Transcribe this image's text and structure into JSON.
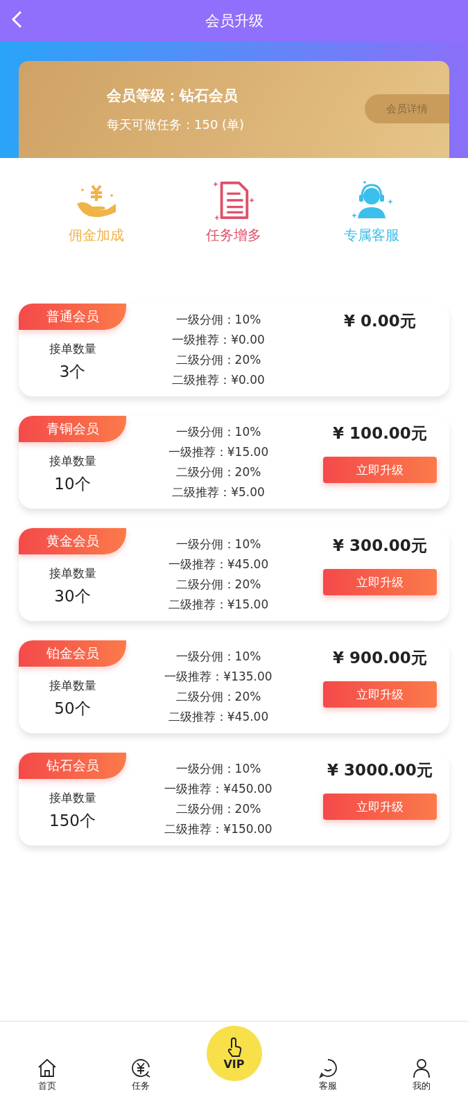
{
  "header": {
    "title": "会员升级"
  },
  "status_card": {
    "level_text": "会员等级：钻石会员",
    "tasks_text": "每天可做任务：150 (单)",
    "details_button": "会员详情"
  },
  "features": [
    {
      "kind": "commission",
      "label": "佣金加成",
      "color": "#f0b347"
    },
    {
      "kind": "tasks",
      "label": "任务增多",
      "color": "#e0506a"
    },
    {
      "kind": "service",
      "label": "专属客服",
      "color": "#3cbfea"
    }
  ],
  "levels": [
    {
      "name": "普通会员",
      "orders_label": "接单数量",
      "orders": "3个",
      "lines": [
        "一级分佣：10%",
        "一级推荐：¥0.00",
        "二级分佣：20%",
        "二级推荐：¥0.00"
      ],
      "price": "¥ 0.00元"
    },
    {
      "name": "青铜会员",
      "orders_label": "接单数量",
      "orders": "10个",
      "lines": [
        "一级分佣：10%",
        "一级推荐：¥15.00",
        "二级分佣：20%",
        "二级推荐：¥5.00"
      ],
      "price": "¥ 100.00元",
      "button": "立即升级"
    },
    {
      "name": "黄金会员",
      "orders_label": "接单数量",
      "orders": "30个",
      "lines": [
        "一级分佣：10%",
        "一级推荐：¥45.00",
        "二级分佣：20%",
        "二级推荐：¥15.00"
      ],
      "price": "¥ 300.00元",
      "button": "立即升级"
    },
    {
      "name": "铂金会员",
      "orders_label": "接单数量",
      "orders": "50个",
      "lines": [
        "一级分佣：10%",
        "一级推荐：¥135.00",
        "二级分佣：20%",
        "二级推荐：¥45.00"
      ],
      "price": "¥ 900.00元",
      "button": "立即升级"
    },
    {
      "name": "钻石会员",
      "orders_label": "接单数量",
      "orders": "150个",
      "lines": [
        "一级分佣：10%",
        "一级推荐：¥450.00",
        "二级分佣：20%",
        "二级推荐：¥150.00"
      ],
      "price": "¥ 3000.00元",
      "button": "立即升级"
    }
  ],
  "nav": [
    {
      "kind": "home",
      "label": "首页"
    },
    {
      "kind": "tasks",
      "label": "任务"
    },
    {
      "kind": "vip",
      "label": "VIP"
    },
    {
      "kind": "chat",
      "label": "客服"
    },
    {
      "kind": "profile",
      "label": "我的"
    }
  ]
}
